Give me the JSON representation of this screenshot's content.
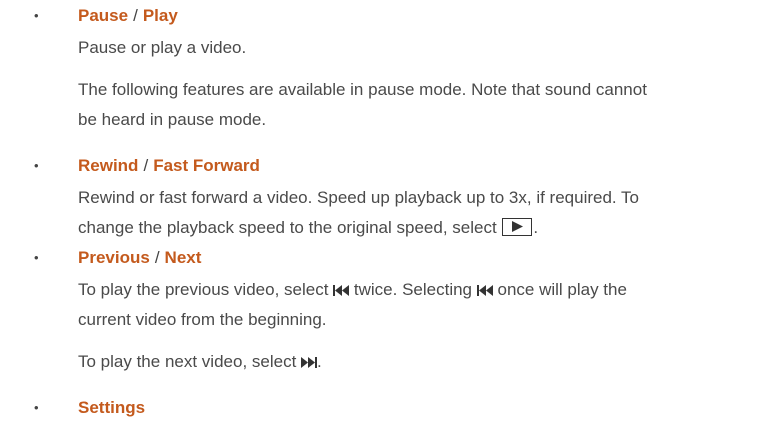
{
  "items": [
    {
      "bullet": "•",
      "title_a": "Pause",
      "sep": "/",
      "title_b": "Play",
      "paragraphs": [
        "Pause or play a video.",
        "The following features are available in pause mode. Note that sound cannot",
        "be heard in pause mode."
      ]
    },
    {
      "bullet": "•",
      "title_a": "Rewind",
      "sep": "/",
      "title_b": "Fast Forward",
      "paragraphs": [
        "Rewind or fast forward a video. Speed up playback up to 3x, if required. To",
        "change the playback speed to the original speed, select",
        "."
      ]
    },
    {
      "bullet": "•",
      "title_a": "Previous",
      "sep": "/",
      "title_b": "Next",
      "paragraphs": [
        "To play the previous video, select",
        "twice. Selecting",
        "once will play the",
        "current video from the beginning.",
        "To play the next video, select",
        "."
      ]
    },
    {
      "bullet": "•",
      "title_a": "Settings"
    }
  ],
  "icons": {
    "play": "play-icon",
    "previous": "previous-icon",
    "next": "next-icon"
  }
}
